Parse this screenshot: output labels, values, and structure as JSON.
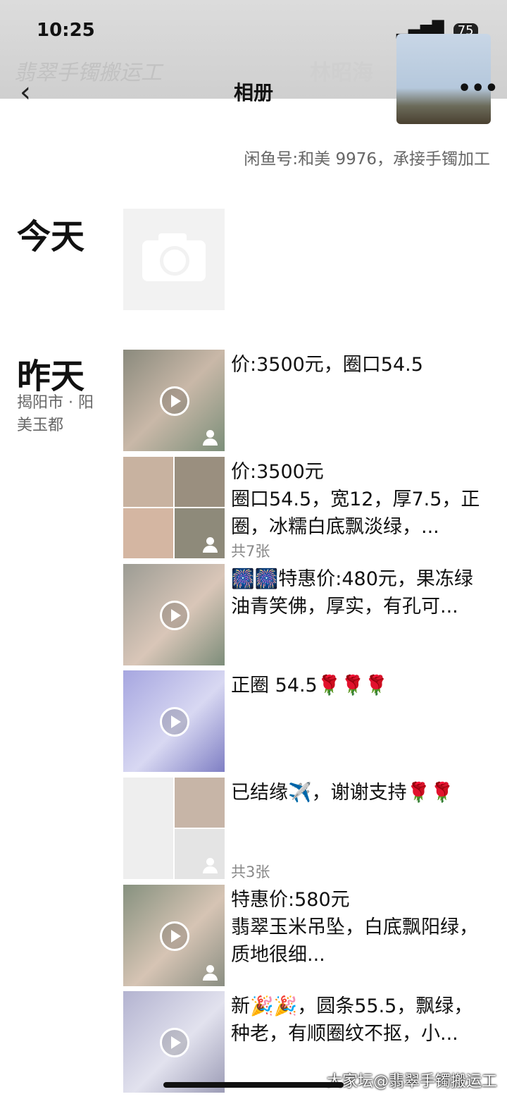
{
  "status": {
    "time": "10:25",
    "signal": "▂▄▆█",
    "wifi": "📶",
    "battery": "75"
  },
  "cover": {
    "text": "翡翠手镯搬运工",
    "nickname": "林昭海"
  },
  "header": {
    "back": "‹",
    "title": "相册",
    "more": "•••"
  },
  "signature": "闲鱼号:和美 9976，承接手镯加工",
  "sections": {
    "today": "今天",
    "yesterday": "昨天",
    "location": "揭阳市 · 阳美玉都"
  },
  "posts": [
    {
      "text": "价:3500元，圈口54.5",
      "type": "video"
    },
    {
      "text": "价:3500元\n圈口54.5，宽12，厚7.5，正圈，冰糯白底飘淡绿，...",
      "count": "共7张",
      "type": "grid"
    },
    {
      "text": "🎆🎆特惠价:480元，果冻绿油青笑佛，厚实，有孔可...",
      "type": "video"
    },
    {
      "text": "正圈 54.5🌹🌹🌹",
      "type": "video"
    },
    {
      "text": "已结缘✈️，谢谢支持🌹🌹",
      "count": "共3张",
      "type": "grid"
    },
    {
      "text": "特惠价:580元\n翡翠玉米吊坠，白底飘阳绿，质地很细...",
      "type": "video"
    },
    {
      "text": "新🎉🎉，圆条55.5，飘绿，种老，有顺圈纹不抠，小...",
      "type": "video"
    }
  ],
  "footer": "大家坛@翡翠手镯搬运工",
  "colors": {
    "accent": "#9fd3c7",
    "muted": "#666666"
  }
}
